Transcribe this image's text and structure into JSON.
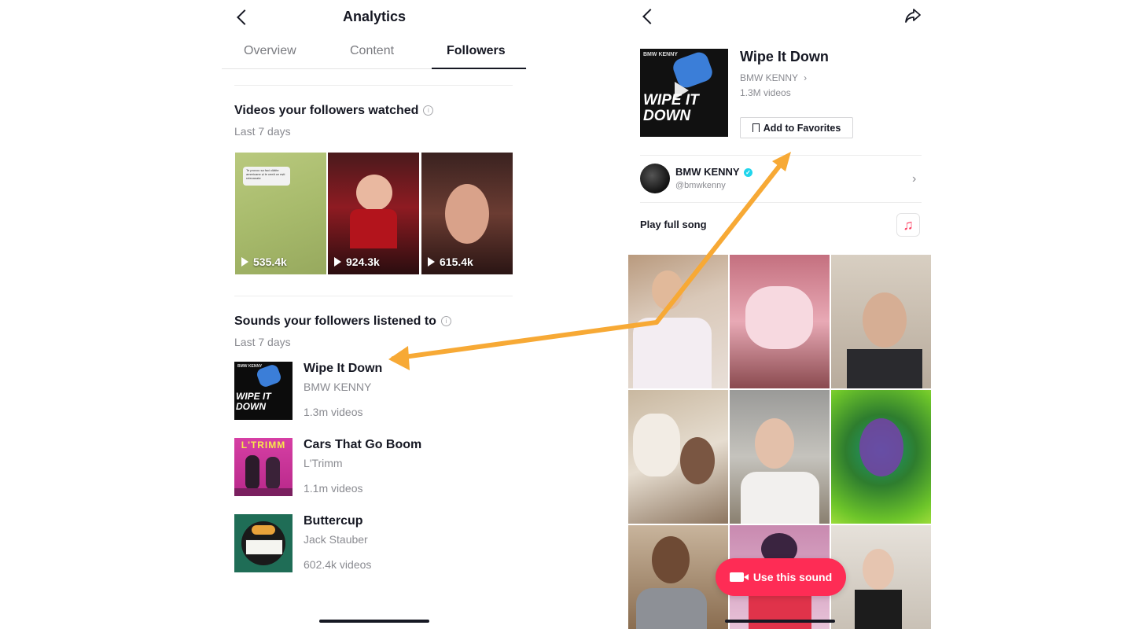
{
  "colors": {
    "accent": "#fe2c55",
    "arrow": "#f7a935",
    "verified": "#20d5ec"
  },
  "analytics": {
    "title": "Analytics",
    "tabs": [
      {
        "label": "Overview",
        "active": false
      },
      {
        "label": "Content",
        "active": false
      },
      {
        "label": "Followers",
        "active": true
      }
    ],
    "videos_section": {
      "title": "Videos your followers watched",
      "subtitle": "Last 7 days",
      "videos": [
        {
          "views": "535.4k",
          "caption": "Te provoc sa faci clätite americane și le ceeă ce ești relevanate"
        },
        {
          "views": "924.3k"
        },
        {
          "views": "615.4k"
        }
      ]
    },
    "sounds_section": {
      "title": "Sounds your followers listened to",
      "subtitle": "Last 7 days",
      "sounds": [
        {
          "title": "Wipe It Down",
          "artist": "BMW KENNY",
          "count": "1.3m videos"
        },
        {
          "title": "Cars That Go Boom",
          "artist": "L'Trimm",
          "count": "1.1m videos"
        },
        {
          "title": "Buttercup",
          "artist": "Jack Stauber",
          "count": "602.4k videos"
        }
      ]
    }
  },
  "sound_page": {
    "album_art": {
      "label": "BMW KENNY",
      "art_text": "WIPE IT DOWN"
    },
    "title": "Wipe It Down",
    "artist": "BMW KENNY",
    "video_count": "1.3M videos",
    "favorite_label": "Add to Favorites",
    "creator": {
      "name": "BMW KENNY",
      "handle": "@bmwkenny"
    },
    "play_full_song": "Play full song",
    "use_sound_label": "Use this sound"
  },
  "cover_art": {
    "cars_label": "L'TRIMM"
  }
}
